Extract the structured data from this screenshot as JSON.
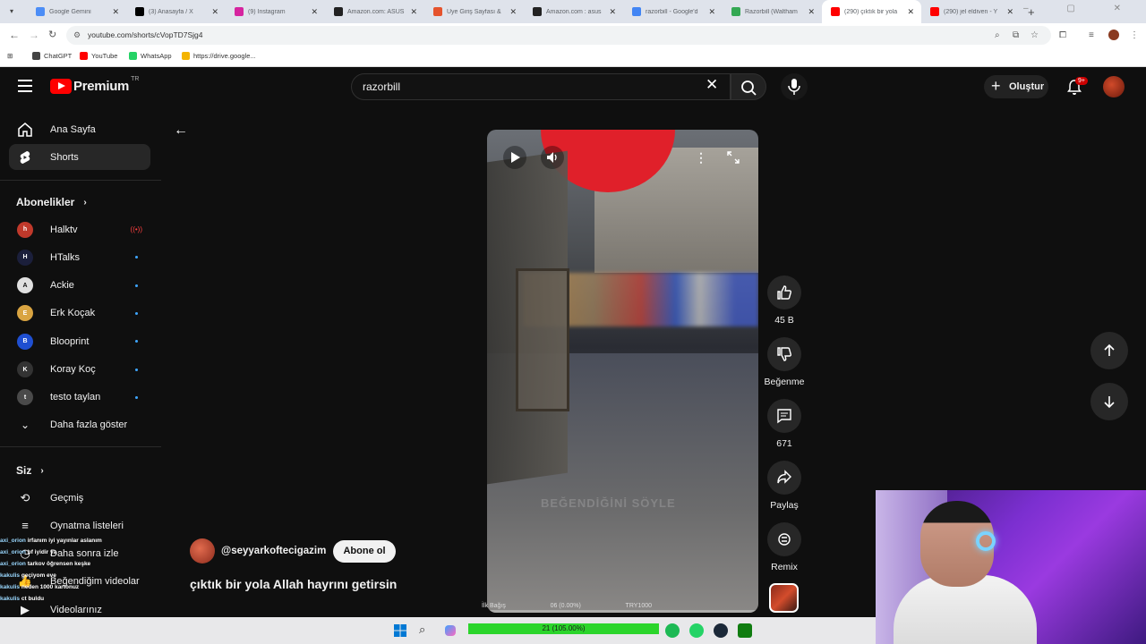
{
  "browser": {
    "tabs": [
      {
        "title": "Google Gemini",
        "color": "#4c8df6"
      },
      {
        "title": "(3) Anasayfa / X",
        "color": "#000000"
      },
      {
        "title": "(9) Instagram",
        "color": "#d6249f"
      },
      {
        "title": "Amazon.com: ASUS",
        "color": "#222222"
      },
      {
        "title": "Üye Giriş Sayfası &",
        "color": "#e5532d"
      },
      {
        "title": "Amazon.com : asus",
        "color": "#222222"
      },
      {
        "title": "razorbill - Google'd",
        "color": "#4285f4"
      },
      {
        "title": "Razorbill (Waltham",
        "color": "#34a853"
      },
      {
        "title": "(290) çıktık bir yola",
        "color": "#ff0000",
        "active": true
      },
      {
        "title": "(290) jel eldiven - Y",
        "color": "#ff0000"
      }
    ],
    "new_tab": "+",
    "url": "youtube.com/shorts/cVopTD7Sjg4",
    "bookmarks": [
      {
        "label": "ChatGPT",
        "color": "#444444"
      },
      {
        "label": "YouTube",
        "color": "#ff0000"
      },
      {
        "label": "WhatsApp",
        "color": "#25d366"
      },
      {
        "label": "https://drive.google...",
        "color": "#f4b400"
      }
    ]
  },
  "youtube": {
    "logo_text": "Premium",
    "country_code": "TR",
    "search_value": "razorbill",
    "create_label": "Oluştur",
    "notif_badge": "9+",
    "sidebar": {
      "main": [
        {
          "label": "Ana Sayfa",
          "icon": "home-icon"
        },
        {
          "label": "Shorts",
          "icon": "shorts-icon",
          "selected": true
        }
      ],
      "subs_title": "Abonelikler",
      "subs": [
        {
          "label": "Halktv",
          "color": "#c0392b",
          "initial": "h",
          "live": true
        },
        {
          "label": "HTalks",
          "color": "#1b1f3b",
          "initial": "H"
        },
        {
          "label": "Ackie",
          "color": "#e0e0e0",
          "initial": "A"
        },
        {
          "label": "Erk Koçak",
          "color": "#d9a441",
          "initial": "E"
        },
        {
          "label": "Bloo​print",
          "color": "#1f4fd1",
          "initial": "B"
        },
        {
          "label": "Koray Koç",
          "color": "#333333",
          "initial": "K"
        },
        {
          "label": "testo taylan",
          "color": "#4a4a4a",
          "initial": "t"
        }
      ],
      "show_more": "Daha fazla göster",
      "you_title": "Siz",
      "you": [
        {
          "label": "Geçmiş",
          "icon": "history-icon"
        },
        {
          "label": "Oynatma listeleri",
          "icon": "playlist-icon"
        },
        {
          "label": "Daha sonra izle",
          "icon": "clock-icon"
        },
        {
          "label": "Beğendiğim videolar",
          "icon": "like-icon"
        },
        {
          "label": "Videolarınız",
          "icon": "video-icon"
        }
      ]
    },
    "actions": [
      {
        "label": "45 B",
        "icon": "like-icon"
      },
      {
        "label": "Beğenme",
        "icon": "dislike-icon"
      },
      {
        "label": "671",
        "icon": "comment-icon"
      },
      {
        "label": "Paylaş",
        "icon": "share-icon"
      },
      {
        "label": "Remix",
        "icon": "remix-icon"
      }
    ],
    "channel": "@seyyarkoftecigazim",
    "subscribe_label": "Abone ol",
    "video_title": "çıktık bir yola Allah hayrını getirsin",
    "video_watermark": "BEĞENDİĞİNİ SÖYLE"
  },
  "chat": [
    {
      "user": "axi_orion",
      "msg": "irfanım iyi yayınlar aslanım"
    },
    {
      "user": "axi_orion",
      "msg": "bf iyidir ya"
    },
    {
      "user": "axi_orion",
      "msg": "tarkov öğrensen keşke"
    },
    {
      "user": "kakulis",
      "msg": "geçiyom eve"
    },
    {
      "user": "kakulis",
      "msg": "neden 1000 kartonuz"
    },
    {
      "user": "kakulis",
      "msg": "ct buldu"
    }
  ],
  "stream_stats": {
    "left": "İlk Bağış",
    "mid": "06 (0.00%)",
    "right": "TRY1000",
    "bar": "21 (105.00%)"
  }
}
